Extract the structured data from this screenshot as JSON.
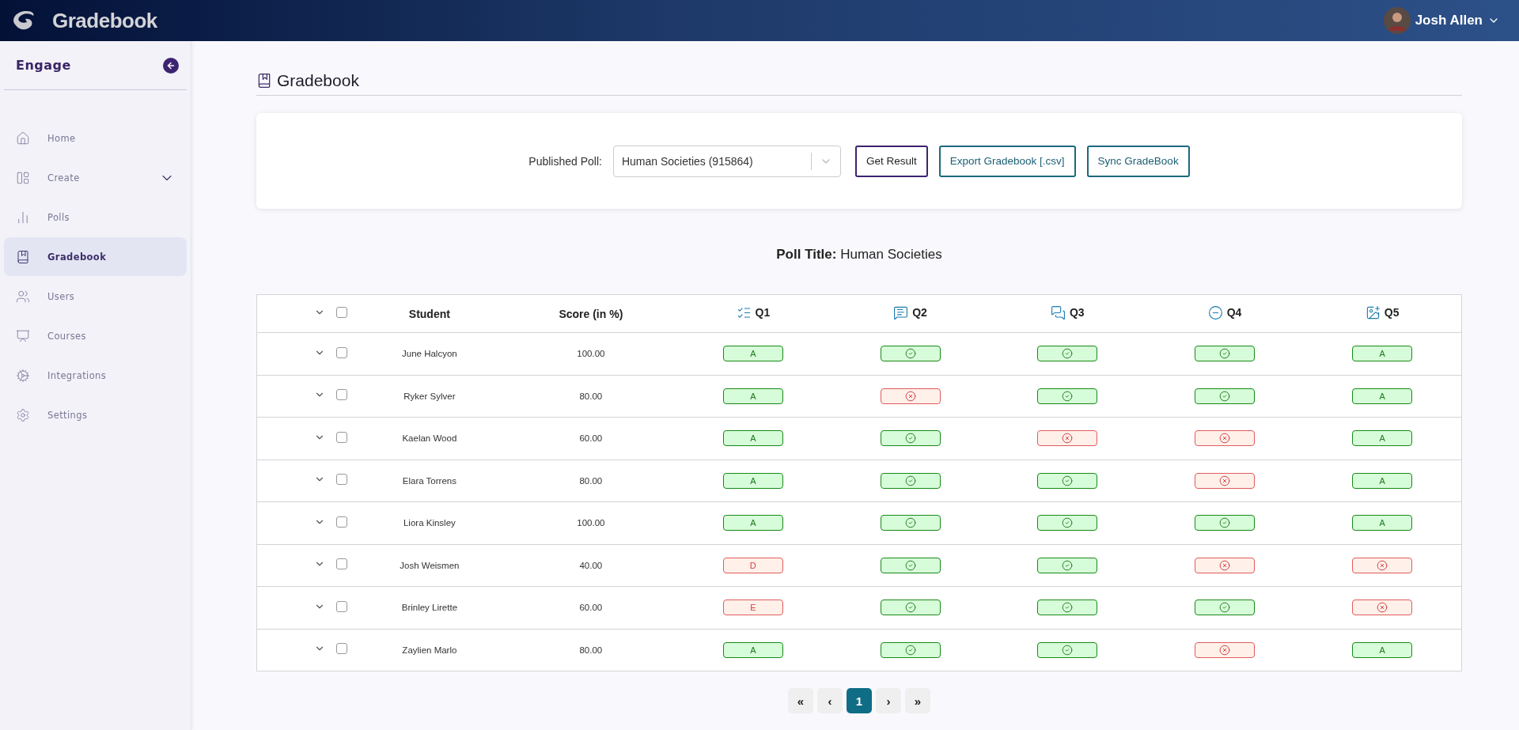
{
  "header": {
    "app_title": "Gradebook",
    "user_name": "Josh Allen"
  },
  "sidebar": {
    "title": "Engage",
    "items": [
      {
        "label": "Home",
        "selected": false
      },
      {
        "label": "Create",
        "selected": false,
        "expanded": false
      },
      {
        "label": "Polls",
        "selected": false
      },
      {
        "label": "Gradebook",
        "selected": true
      },
      {
        "label": "Users",
        "selected": false
      },
      {
        "label": "Courses",
        "selected": false
      },
      {
        "label": "Integrations",
        "selected": false
      },
      {
        "label": "Settings",
        "selected": false
      }
    ]
  },
  "page_title": "Gradebook",
  "filter": {
    "label": "Published Poll:",
    "value": "Human Societies (915864)",
    "buttons": [
      {
        "label": "Get Result",
        "kind": "primary"
      },
      {
        "label": "Export Gradebook [.csv]",
        "kind": "secondary"
      },
      {
        "label": "Sync GradeBook",
        "kind": "secondary"
      }
    ]
  },
  "poll_title": {
    "label": "Poll Title:",
    "value": "Human Societies"
  },
  "table": {
    "all_checked": false,
    "columns": [
      {
        "label": "Student"
      },
      {
        "label": "Score (in %)"
      },
      {
        "label": "Q1"
      },
      {
        "label": "Q2"
      },
      {
        "label": "Q3"
      },
      {
        "label": "Q4"
      },
      {
        "label": "Q5"
      }
    ],
    "rows": [
      {
        "student": "June Halcyon",
        "score": "100.00",
        "checked": false,
        "answers": [
          {
            "kind": "letter",
            "label": "A",
            "correct": true
          },
          {
            "kind": "mark",
            "correct": true
          },
          {
            "kind": "mark",
            "correct": true
          },
          {
            "kind": "mark",
            "correct": true
          },
          {
            "kind": "letter",
            "label": "A",
            "correct": true
          }
        ]
      },
      {
        "student": "Ryker Sylver",
        "score": "80.00",
        "checked": false,
        "answers": [
          {
            "kind": "letter",
            "label": "A",
            "correct": true
          },
          {
            "kind": "mark",
            "correct": false
          },
          {
            "kind": "mark",
            "correct": true
          },
          {
            "kind": "mark",
            "correct": true
          },
          {
            "kind": "letter",
            "label": "A",
            "correct": true
          }
        ]
      },
      {
        "student": "Kaelan Wood",
        "score": "60.00",
        "checked": false,
        "answers": [
          {
            "kind": "letter",
            "label": "A",
            "correct": true
          },
          {
            "kind": "mark",
            "correct": true
          },
          {
            "kind": "mark",
            "correct": false
          },
          {
            "kind": "mark",
            "correct": false
          },
          {
            "kind": "letter",
            "label": "A",
            "correct": true
          }
        ]
      },
      {
        "student": "Elara Torrens",
        "score": "80.00",
        "checked": false,
        "answers": [
          {
            "kind": "letter",
            "label": "A",
            "correct": true
          },
          {
            "kind": "mark",
            "correct": true
          },
          {
            "kind": "mark",
            "correct": true
          },
          {
            "kind": "mark",
            "correct": false
          },
          {
            "kind": "letter",
            "label": "A",
            "correct": true
          }
        ]
      },
      {
        "student": "Liora Kinsley",
        "score": "100.00",
        "checked": false,
        "answers": [
          {
            "kind": "letter",
            "label": "A",
            "correct": true
          },
          {
            "kind": "mark",
            "correct": true
          },
          {
            "kind": "mark",
            "correct": true
          },
          {
            "kind": "mark",
            "correct": true
          },
          {
            "kind": "letter",
            "label": "A",
            "correct": true
          }
        ]
      },
      {
        "student": "Josh Weismen",
        "score": "40.00",
        "checked": false,
        "answers": [
          {
            "kind": "letter",
            "label": "D",
            "correct": false
          },
          {
            "kind": "mark",
            "correct": true
          },
          {
            "kind": "mark",
            "correct": true
          },
          {
            "kind": "mark",
            "correct": false
          },
          {
            "kind": "mark",
            "correct": false
          }
        ]
      },
      {
        "student": "Brinley Lirette",
        "score": "60.00",
        "checked": false,
        "answers": [
          {
            "kind": "letter",
            "label": "E",
            "correct": false
          },
          {
            "kind": "mark",
            "correct": true
          },
          {
            "kind": "mark",
            "correct": true
          },
          {
            "kind": "mark",
            "correct": true
          },
          {
            "kind": "mark",
            "correct": false
          }
        ]
      },
      {
        "student": "Zaylien Marlo",
        "score": "80.00",
        "checked": false,
        "answers": [
          {
            "kind": "letter",
            "label": "A",
            "correct": true
          },
          {
            "kind": "mark",
            "correct": true
          },
          {
            "kind": "mark",
            "correct": true
          },
          {
            "kind": "mark",
            "correct": false
          },
          {
            "kind": "letter",
            "label": "A",
            "correct": true
          }
        ]
      }
    ]
  },
  "pagination": [
    {
      "label": "«",
      "selected": false
    },
    {
      "label": "‹",
      "selected": false
    },
    {
      "label": "1",
      "selected": true
    },
    {
      "label": "›",
      "selected": false
    },
    {
      "label": "»",
      "selected": false
    }
  ]
}
